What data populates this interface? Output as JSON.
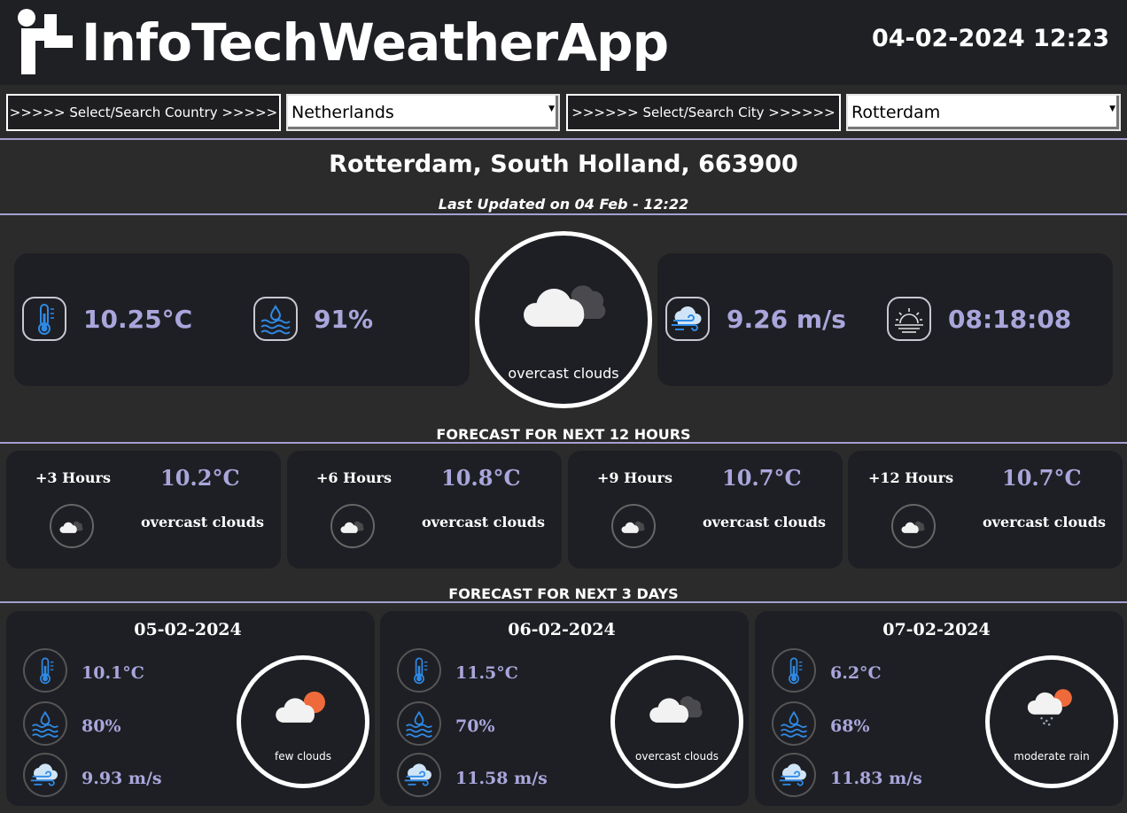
{
  "header": {
    "app_title": "InfoTechWeatherApp",
    "datetime": "04-02-2024 12:23"
  },
  "selectors": {
    "country_label": ">>>>> Select/Search Country >>>>>",
    "country_value": "Netherlands",
    "city_label": ">>>>>> Select/Search City >>>>>>",
    "city_value": "Rotterdam"
  },
  "location": {
    "title": "Rotterdam, South Holland, 663900",
    "updated": "Last Updated on 04 Feb - 12:22"
  },
  "current": {
    "temperature": "10.25°C",
    "humidity": "91%",
    "condition": "overcast clouds",
    "wind": "9.26 m/s",
    "sunrise": "08:18:08"
  },
  "hourly": {
    "title": "FORECAST FOR NEXT 12 HOURS",
    "items": [
      {
        "label": "+3 Hours",
        "temp": "10.2°C",
        "desc": "overcast clouds"
      },
      {
        "label": "+6 Hours",
        "temp": "10.8°C",
        "desc": "overcast clouds"
      },
      {
        "label": "+9 Hours",
        "temp": "10.7°C",
        "desc": "overcast clouds"
      },
      {
        "label": "+12 Hours",
        "temp": "10.7°C",
        "desc": "overcast clouds"
      }
    ]
  },
  "daily": {
    "title": "FORECAST FOR NEXT 3 DAYS",
    "items": [
      {
        "date": "05-02-2024",
        "temp": "10.1°C",
        "humidity": "80%",
        "wind": "9.93 m/s",
        "desc": "few clouds",
        "icon": "few-clouds-icon"
      },
      {
        "date": "06-02-2024",
        "temp": "11.5°C",
        "humidity": "70%",
        "wind": "11.58 m/s",
        "desc": "overcast clouds",
        "icon": "overcast-clouds-icon"
      },
      {
        "date": "07-02-2024",
        "temp": "6.2°C",
        "humidity": "68%",
        "wind": "11.83 m/s",
        "desc": "moderate rain",
        "icon": "moderate-rain-icon"
      }
    ]
  },
  "colors": {
    "accent": "#aaa6dc",
    "panel": "#1e1f24",
    "background": "#2b2b2b",
    "icon_blue": "#3a8fe0"
  }
}
